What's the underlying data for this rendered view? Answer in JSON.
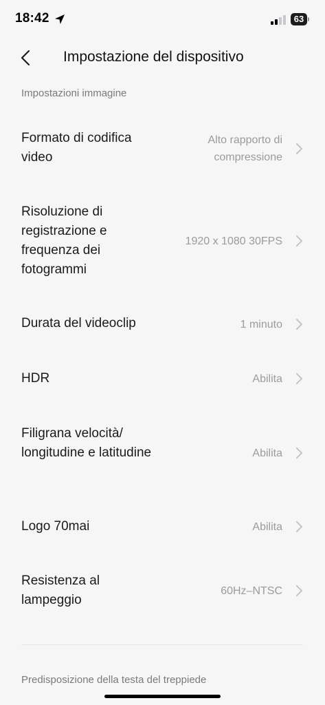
{
  "status_bar": {
    "time": "18:42",
    "battery_level": "63",
    "location_icon": "location-arrow-icon",
    "signal_icon": "cellular-signal-icon"
  },
  "header": {
    "title": "Impostazione del dispositivo",
    "back_icon": "chevron-left-icon"
  },
  "sections": {
    "image_settings_title": "Impostazioni immagine",
    "tripod_title": "Predisposizione della testa del treppiede"
  },
  "settings": [
    {
      "label": "Formato di codifica video",
      "value": "Alto rapporto di compressione"
    },
    {
      "label": "Risoluzione di registrazione e frequenza dei fotogrammi",
      "value": "1920 x 1080 30FPS"
    },
    {
      "label": "Durata del videoclip",
      "value": "1 minuto"
    },
    {
      "label": "HDR",
      "value": "Abilita"
    },
    {
      "label": "Filigrana velocità/ longitudine e latitudine",
      "value": "Abilita"
    },
    {
      "label": "Logo 70mai",
      "value": "Abilita"
    },
    {
      "label": "Resistenza al lampeggio",
      "value": "60Hz–NTSC"
    }
  ],
  "colors": {
    "background": "#f6f6f6",
    "primary_text": "#1a1a1a",
    "secondary_text": "#9b9b9b",
    "section_text": "#7a7a7a",
    "chevron": "#c4c4c4"
  }
}
